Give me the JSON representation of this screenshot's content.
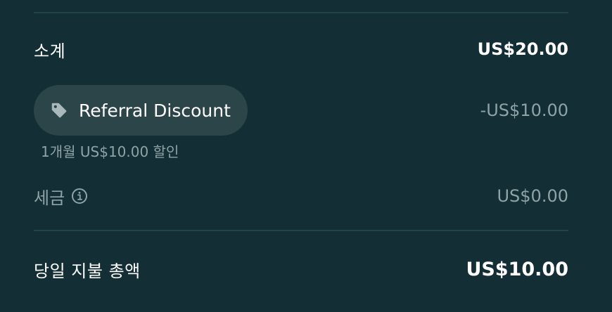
{
  "summary": {
    "subtotal": {
      "label": "소계",
      "value": "US$20.00"
    },
    "promo": {
      "name": "Referral Discount",
      "amount": "-US$10.00",
      "note": "1개월 US$10.00 할인",
      "icon": "tag-icon"
    },
    "tax": {
      "label": "세금",
      "value": "US$0.00",
      "icon": "info-icon"
    },
    "total": {
      "label": "당일 지불 총액",
      "value": "US$10.00"
    }
  },
  "colors": {
    "background": "#132f35",
    "divider": "#21434a",
    "pill": "#2b4549",
    "muted_text": "#8fa3a7",
    "text": "#ffffff"
  }
}
